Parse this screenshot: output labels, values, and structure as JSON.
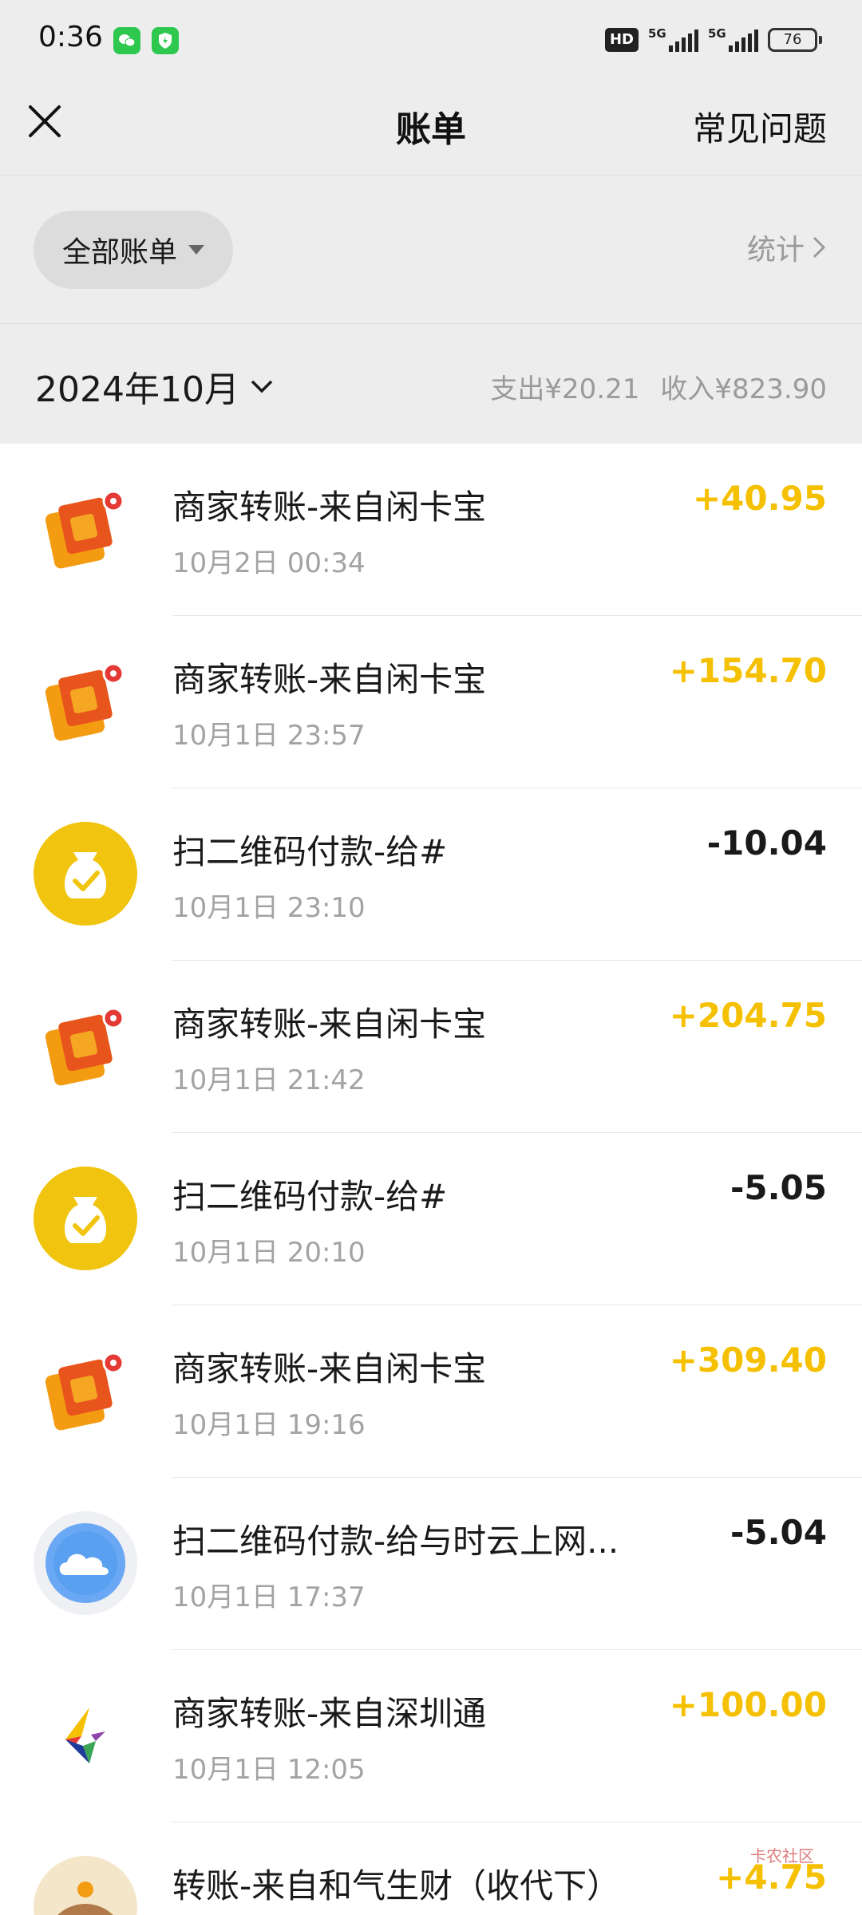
{
  "status_bar": {
    "time": "0:36",
    "hd_label": "HD",
    "net1": "5G",
    "net2": "5G",
    "battery": "76"
  },
  "nav": {
    "title": "账单",
    "faq_label": "常见问题"
  },
  "filter": {
    "all_bills_label": "全部账单",
    "stats_label": "统计"
  },
  "month": {
    "label": "2024年10月",
    "expense": "支出¥20.21",
    "income": "收入¥823.90"
  },
  "colors": {
    "income_amount": "#f5c000",
    "background_header": "#ededed",
    "wechat_green": "#2dc84d"
  },
  "transactions": [
    {
      "icon": "wallet-icon",
      "title": "商家转账-来自闲卡宝",
      "time": "10月2日 00:34",
      "amount": "+40.95",
      "type": "income"
    },
    {
      "icon": "wallet-icon",
      "title": "商家转账-来自闲卡宝",
      "time": "10月1日 23:57",
      "amount": "+154.70",
      "type": "income"
    },
    {
      "icon": "money-bag-icon",
      "title": "扫二维码付款-给#",
      "time": "10月1日 23:10",
      "amount": "-10.04",
      "type": "expense"
    },
    {
      "icon": "wallet-icon",
      "title": "商家转账-来自闲卡宝",
      "time": "10月1日 21:42",
      "amount": "+204.75",
      "type": "income"
    },
    {
      "icon": "money-bag-icon",
      "title": "扫二维码付款-给#",
      "time": "10月1日 20:10",
      "amount": "-5.05",
      "type": "expense"
    },
    {
      "icon": "wallet-icon",
      "title": "商家转账-来自闲卡宝",
      "time": "10月1日 19:16",
      "amount": "+309.40",
      "type": "income"
    },
    {
      "icon": "cloud-icon",
      "title": "扫二维码付款-给与时云上网...",
      "time": "10月1日 17:37",
      "amount": "-5.04",
      "type": "expense"
    },
    {
      "icon": "shenzhentong-logo-icon",
      "title": "商家转账-来自深圳通",
      "time": "10月1日 12:05",
      "amount": "+100.00",
      "type": "income"
    },
    {
      "icon": "bear-avatar-icon",
      "title": "转账-来自和气生财（收代下）",
      "time": "",
      "amount": "+4.75",
      "type": "income"
    }
  ],
  "watermark": "卡农社区"
}
